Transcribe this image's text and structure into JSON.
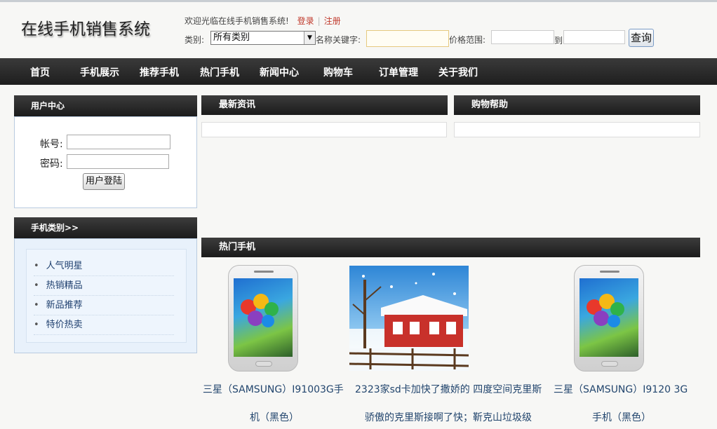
{
  "header": {
    "logo": "在线手机销售系统",
    "welcome": "欢迎光临在线手机销售系统!",
    "login_link": "登录",
    "register_link": "注册"
  },
  "search": {
    "category_label": "类别:",
    "category_selected": "所有类别",
    "keyword_label": "名称关键字:",
    "price_label": "价格范围:",
    "to_label": "到",
    "submit": "查询"
  },
  "nav": [
    "首页",
    "手机展示",
    "推荐手机",
    "热门手机",
    "新闻中心",
    "购物车",
    "订单管理",
    "关于我们"
  ],
  "user_center": {
    "title": "用户中心",
    "account_label": "帐号:",
    "password_label": "密码:",
    "login_button": "用户登陆"
  },
  "categories": {
    "title": "手机类别>>",
    "items": [
      "人气明星",
      "热销精品",
      "新品推荐",
      "特价热卖"
    ]
  },
  "news": {
    "title": "最新资讯"
  },
  "help": {
    "title": "购物帮助"
  },
  "hot": {
    "title": "热门手机",
    "products": [
      {
        "name_line1": "三星（SAMSUNG）I91003G手",
        "name_line2": "机（黑色）",
        "image": "phone-image"
      },
      {
        "name_line1": "2323家sd卡加快了撒娇的 四度空间克里斯",
        "name_line2": "骄傲的克里斯接啊了快；靳克山垃圾级",
        "image": "winter-house-image"
      },
      {
        "name_line1": "三星（SAMSUNG）I9120 3G",
        "name_line2": "手机（黑色）",
        "image": "phone-image"
      }
    ]
  }
}
